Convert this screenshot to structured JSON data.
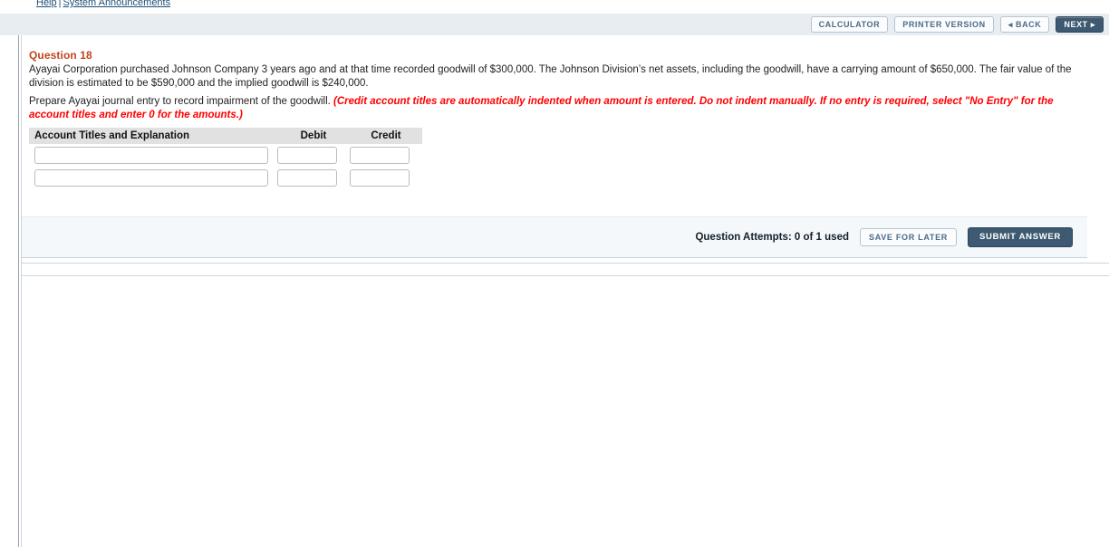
{
  "masthead": {
    "logo_name": "wileyplus-logo",
    "links": [
      {
        "label": "Help"
      },
      {
        "label": "System Announcements"
      }
    ],
    "separator": "|"
  },
  "toolbar": {
    "calculator_label": "CALCULATOR",
    "printer_version_label": "PRINTER VERSION",
    "back_label": "◂ BACK",
    "next_label": "NEXT ▸"
  },
  "question": {
    "title": "Question 18",
    "body": "Ayayai Corporation purchased Johnson Company 3 years ago and at that time recorded goodwill of $300,000. The Johnson Division’s net assets, including the goodwill, have a carrying amount of $650,000. The fair value of the division is estimated to be $590,000 and the implied goodwill is $240,000.",
    "instruction_lead": "Prepare Ayayai journal entry to record impairment of the goodwill. ",
    "instruction_emphasis": "(Credit account titles are automatically indented when amount is entered. Do not indent manually. If no entry is required, select \"No Entry\" for the account titles and enter 0 for the amounts.)"
  },
  "entry_table": {
    "headers": {
      "account": "Account Titles and Explanation",
      "debit": "Debit",
      "credit": "Credit"
    },
    "rows": [
      {
        "account": "",
        "debit": "",
        "credit": ""
      },
      {
        "account": "",
        "debit": "",
        "credit": ""
      }
    ]
  },
  "footer": {
    "attempts_text": "Question Attempts: 0 of 1 used",
    "save_for_later_label": "SAVE FOR LATER",
    "submit_answer_label": "SUBMIT ANSWER"
  }
}
